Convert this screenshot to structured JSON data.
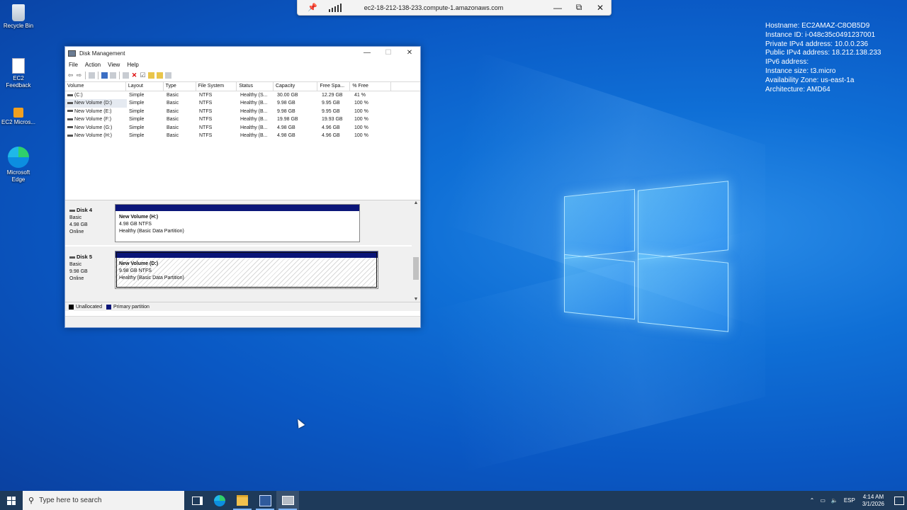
{
  "desktop": {
    "icons": [
      {
        "label": "Recycle Bin"
      },
      {
        "label": "EC2 Feedback"
      },
      {
        "label": "EC2 Micros..."
      },
      {
        "label": "Microsoft Edge"
      }
    ],
    "system_info": {
      "hostname": "Hostname: EC2AMAZ-C8OB5D9",
      "instance_id": "Instance ID: i-048c35c0491237001",
      "private_ipv4": "Private IPv4 address: 10.0.0.236",
      "public_ipv4": "Public IPv4 address: 18.212.138.233",
      "ipv6": "IPv6 address:",
      "instance_size": "Instance size: t3.micro",
      "availability_zone": "Availability Zone: us-east-1a",
      "architecture": "Architecture: AMD64"
    }
  },
  "rdp_bar": {
    "host": "ec2-18-212-138-233.compute-1.amazonaws.com",
    "minimize": "—",
    "restore": "⧉",
    "close": "✕"
  },
  "window": {
    "title": "Disk Management",
    "controls": {
      "minimize": "—",
      "maximize": "☐",
      "close": "✕"
    },
    "menu": [
      "File",
      "Action",
      "View",
      "Help"
    ],
    "columns": [
      "Volume",
      "Layout",
      "Type",
      "File System",
      "Status",
      "Capacity",
      "Free Spa...",
      "% Free",
      ""
    ],
    "volumes": [
      {
        "volume": "(C:)",
        "layout": "Simple",
        "type": "Basic",
        "fs": "NTFS",
        "status": "Healthy (S...",
        "capacity": "30.00 GB",
        "free": "12.29 GB",
        "pct": "41 %"
      },
      {
        "volume": "New Volume (D:)",
        "layout": "Simple",
        "type": "Basic",
        "fs": "NTFS",
        "status": "Healthy (B...",
        "capacity": "9.98 GB",
        "free": "9.95 GB",
        "pct": "100 %"
      },
      {
        "volume": "New Volume (E:)",
        "layout": "Simple",
        "type": "Basic",
        "fs": "NTFS",
        "status": "Healthy (B...",
        "capacity": "9.98 GB",
        "free": "9.95 GB",
        "pct": "100 %"
      },
      {
        "volume": "New Volume (F:)",
        "layout": "Simple",
        "type": "Basic",
        "fs": "NTFS",
        "status": "Healthy (B...",
        "capacity": "19.98 GB",
        "free": "19.93 GB",
        "pct": "100 %"
      },
      {
        "volume": "New Volume (G:)",
        "layout": "Simple",
        "type": "Basic",
        "fs": "NTFS",
        "status": "Healthy (B...",
        "capacity": "4.98 GB",
        "free": "4.96 GB",
        "pct": "100 %"
      },
      {
        "volume": "New Volume (H:)",
        "layout": "Simple",
        "type": "Basic",
        "fs": "NTFS",
        "status": "Healthy (B...",
        "capacity": "4.98 GB",
        "free": "4.96 GB",
        "pct": "100 %"
      }
    ],
    "disks": [
      {
        "name": "Disk 4",
        "type": "Basic",
        "size": "4.98 GB",
        "state": "Online",
        "partition": {
          "name": "New Volume  (H:)",
          "detail": "4.98 GB NTFS",
          "status": "Healthy (Basic Data Partition)"
        }
      },
      {
        "name": "Disk 5",
        "type": "Basic",
        "size": "9.98 GB",
        "state": "Online",
        "partition": {
          "name": "New Volume  (D:)",
          "detail": "9.98 GB NTFS",
          "status": "Healthy (Basic Data Partition)"
        }
      }
    ],
    "legend": {
      "unallocated": "Unallocated",
      "primary": "Primary partition"
    },
    "legend_colors": {
      "unallocated": "#000000",
      "primary": "#0a1578"
    }
  },
  "taskbar": {
    "search_placeholder": "Type here to search",
    "language": "ESP",
    "time": "4:14 AM",
    "date": "3/1/2026"
  }
}
